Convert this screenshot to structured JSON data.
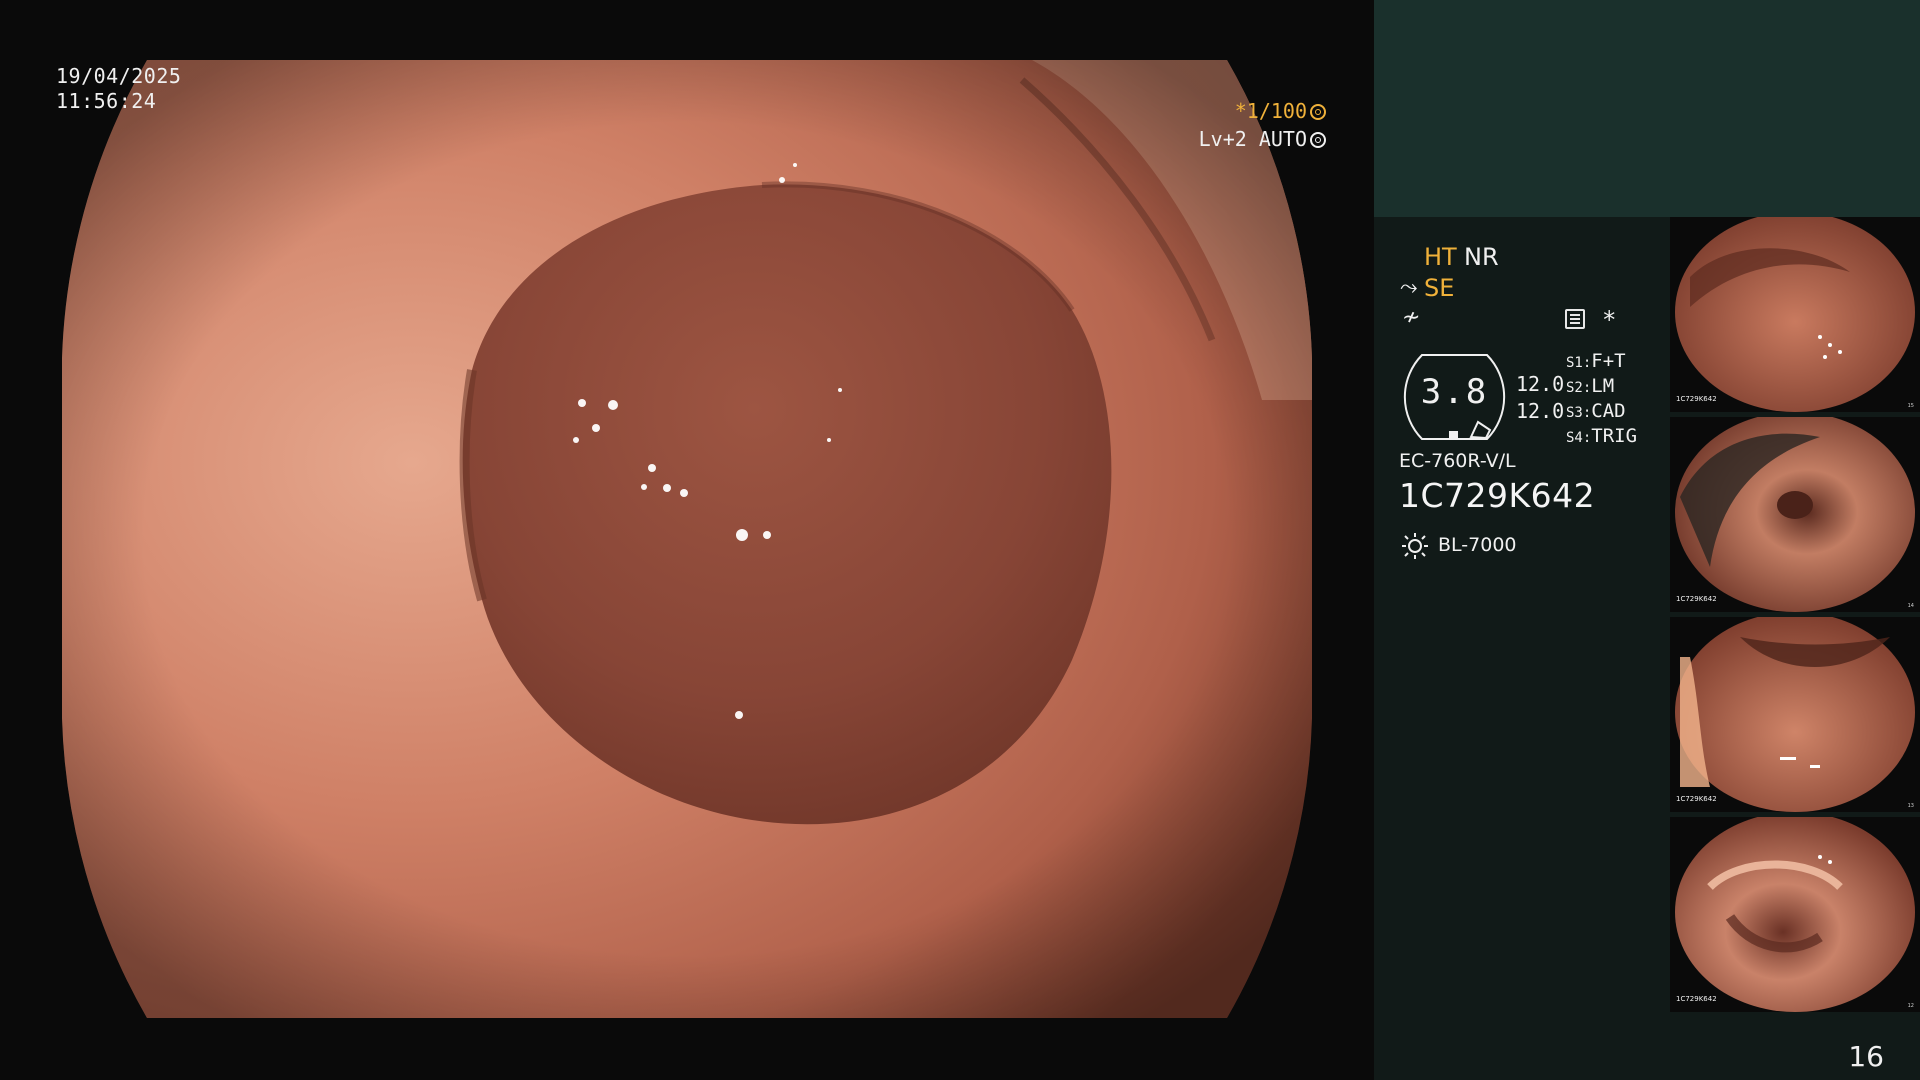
{
  "overlay": {
    "date": "19/04/2025",
    "time": "11:56:24",
    "shutter": "*1/100",
    "level": "Lv+2 AUTO"
  },
  "panel": {
    "modes": {
      "ht": "HT",
      "nr": "NR",
      "se": "SE",
      "se_icon": "tilde-arrow-icon",
      "sharp_icon": "sharpness-icon"
    },
    "star": "*",
    "gauge": {
      "value": "3.8",
      "side1": "12.0",
      "side2": "12.0"
    },
    "switches": [
      {
        "key": "S1:",
        "value": "F+T"
      },
      {
        "key": "S2:",
        "value": "LM"
      },
      {
        "key": "S3:",
        "value": "CAD"
      },
      {
        "key": "S4:",
        "value": "TRIG"
      }
    ],
    "scope_model": "EC-760R-V/L",
    "scope_serial": "1C729K642",
    "light_source": "BL-7000",
    "frame_number": "16"
  },
  "thumbnails": [
    {
      "serial": "1C729K642",
      "index": "15"
    },
    {
      "serial": "1C729K642",
      "index": "14"
    },
    {
      "serial": "1C729K642",
      "index": "13"
    },
    {
      "serial": "1C729K642",
      "index": "12"
    }
  ],
  "colors": {
    "accent": "#f0b13a",
    "panel_bg": "#111a18",
    "panel_header": "#1a302c",
    "tissue": "#b8674f"
  }
}
